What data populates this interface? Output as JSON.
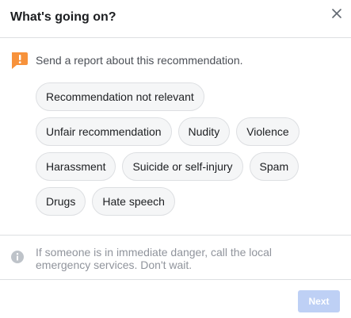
{
  "dialog": {
    "title": "What's going on?",
    "close_icon": "close-icon"
  },
  "report": {
    "icon": "flag-alert-icon",
    "text": "Send a report about this recommendation."
  },
  "options": [
    [
      "Recommendation not relevant"
    ],
    [
      "Unfair recommendation",
      "Nudity",
      "Violence"
    ],
    [
      "Harassment",
      "Suicide or self-injury",
      "Spam"
    ],
    [
      "Drugs",
      "Hate speech"
    ]
  ],
  "info": {
    "icon": "info-icon",
    "text": "If someone is in immediate danger, call the local emergency services. Don't wait."
  },
  "footer": {
    "next_label": "Next",
    "next_enabled": false
  },
  "colors": {
    "alert": "#f7923b",
    "next_disabled": "#bed0f5",
    "chip_bg": "#f5f6f7",
    "border": "#dddfe2"
  }
}
